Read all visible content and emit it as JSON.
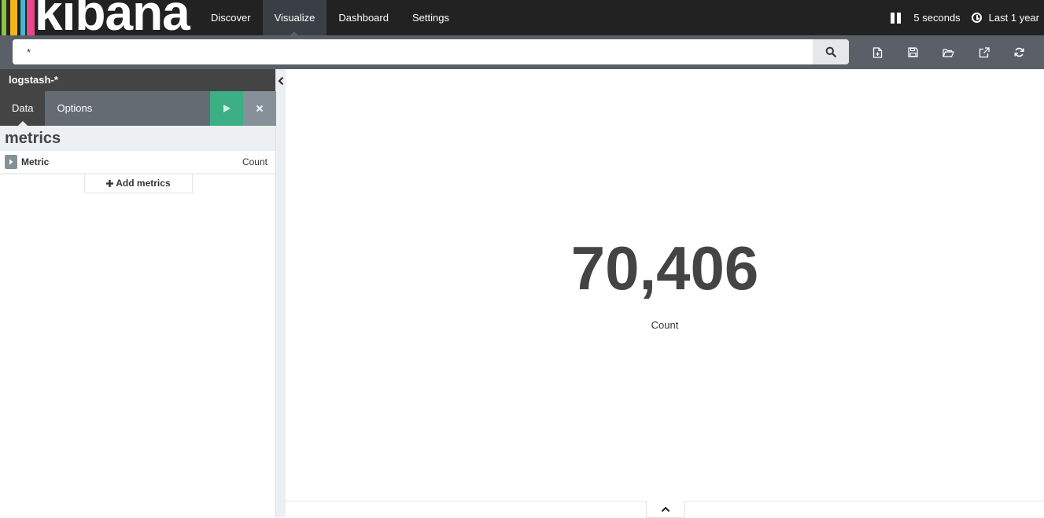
{
  "app": {
    "logo_text": "kibana",
    "logo_colors": [
      "#88c541",
      "#f1b41b",
      "#3dbbce",
      "#e8478b"
    ]
  },
  "nav": {
    "items": [
      {
        "label": "Discover"
      },
      {
        "label": "Visualize",
        "active": true
      },
      {
        "label": "Dashboard"
      },
      {
        "label": "Settings"
      }
    ],
    "refresh_interval": "5 seconds",
    "time_range": "Last 1 year"
  },
  "search": {
    "query": "*"
  },
  "toolbar": {
    "icons": [
      "new-visualization-icon",
      "save-icon",
      "open-icon",
      "share-icon",
      "refresh-icon"
    ]
  },
  "sidebar": {
    "index_pattern": "logstash-*",
    "tabs": [
      {
        "label": "Data",
        "active": true
      },
      {
        "label": "Options"
      }
    ],
    "section_title": "metrics",
    "metric": {
      "title": "Metric",
      "aggregation": "Count"
    },
    "add_metrics_label": "Add metrics"
  },
  "visualization": {
    "value": "70,406",
    "label": "Count"
  },
  "colors": {
    "navbar": "#222222",
    "accent_apply": "#3caf85",
    "search_bar": "#5b6068"
  }
}
